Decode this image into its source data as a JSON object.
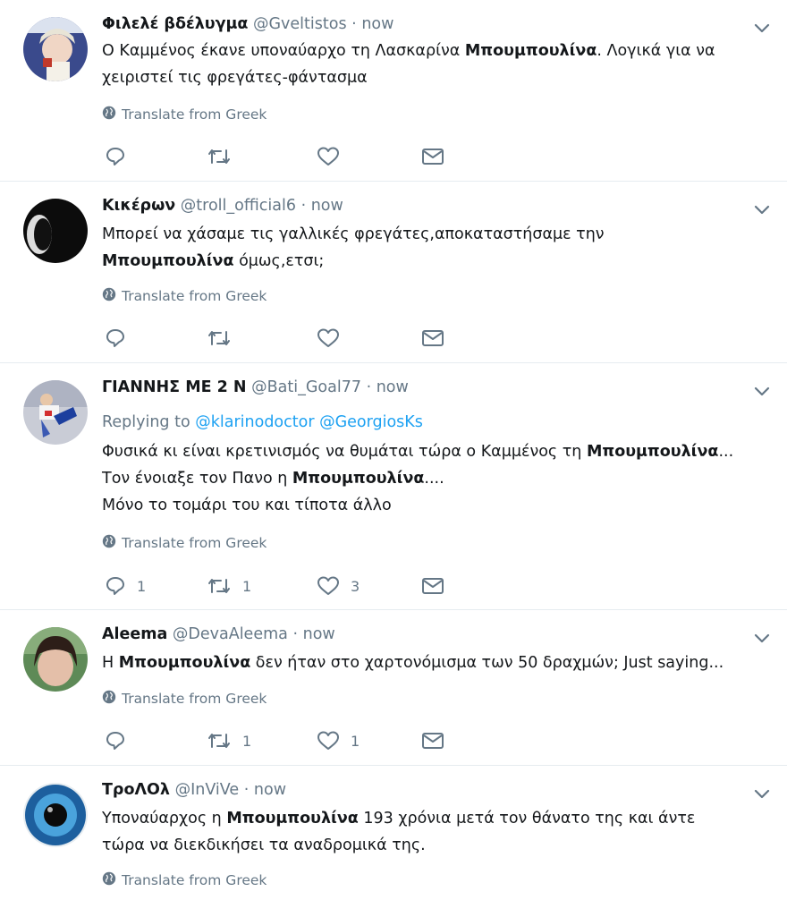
{
  "tweets": [
    {
      "name": "Φιλελέ βδέλυγμα",
      "handle": "@Gveltistos",
      "time": "now",
      "text_lines": [
        [
          "Ο Καμμένος έκανε υποναύαρχο τη Λασκαρίνα ",
          "Μπουμπουλίνα",
          ". Λογικά για να"
        ],
        [
          "χειριστεί τις φρεγάτες-φάντασμα",
          "",
          ""
        ]
      ],
      "translate": "Translate from Greek",
      "reply_count": "",
      "retweet_count": "",
      "like_count": ""
    },
    {
      "name": "Κικέρων",
      "handle": "@troll_official6",
      "time": "now",
      "text_lines": [
        [
          "Μπορεί να χάσαμε τις γαλλικές φρεγάτες,αποκαταστήσαμε την",
          "",
          ""
        ],
        [
          "",
          "Μπουμπουλίνα",
          " όμως,ετσι;"
        ]
      ],
      "translate": "Translate from Greek",
      "reply_count": "",
      "retweet_count": "",
      "like_count": ""
    },
    {
      "name": "ΓΙΑΝΝΗΣ ΜΕ 2 Ν",
      "handle": "@Bati_Goal77",
      "time": "now",
      "replying_label": "Replying to",
      "replying_to": "@klarinodoctor @GeorgiosKs",
      "text_lines": [
        [
          "Φυσικά κι είναι κρετινισμός να θυμάται τώρα ο Καμμένος τη ",
          "Μπουμπουλίνα",
          "..."
        ],
        [
          "Τον ένοιαξε τον Πανο η ",
          "Μπουμπουλίνα",
          "...."
        ],
        [
          "Μόνο το τομάρι του και τίποτα άλλο",
          "",
          ""
        ]
      ],
      "translate": "Translate from Greek",
      "reply_count": "1",
      "retweet_count": "1",
      "like_count": "3"
    },
    {
      "name": "Aleema",
      "handle": "@DevaAleema",
      "time": "now",
      "text_lines": [
        [
          "Η ",
          "Μπουμπουλίνα",
          " δεν ήταν στο χαρτονόμισμα των 50 δραχμών; Just saying..."
        ]
      ],
      "translate": "Translate from Greek",
      "reply_count": "",
      "retweet_count": "1",
      "like_count": "1"
    },
    {
      "name": "ΤροΛΟλ",
      "handle": "@InViVe",
      "time": "now",
      "text_lines": [
        [
          "Υποναύαρχος η ",
          "Μπουμπουλίνα",
          " 193 χρόνια μετά τον θάνατο της και άντε"
        ],
        [
          "τώρα να διεκδικήσει τα αναδρομικά της.",
          "",
          ""
        ]
      ],
      "translate": "Translate from Greek"
    }
  ],
  "colors": {
    "accent": "#1da1f2",
    "muted": "#657786",
    "divider": "#e6ecf0"
  },
  "icons": [
    "globe-icon",
    "chevron-down-icon",
    "reply-icon",
    "retweet-icon",
    "like-icon",
    "message-icon"
  ]
}
